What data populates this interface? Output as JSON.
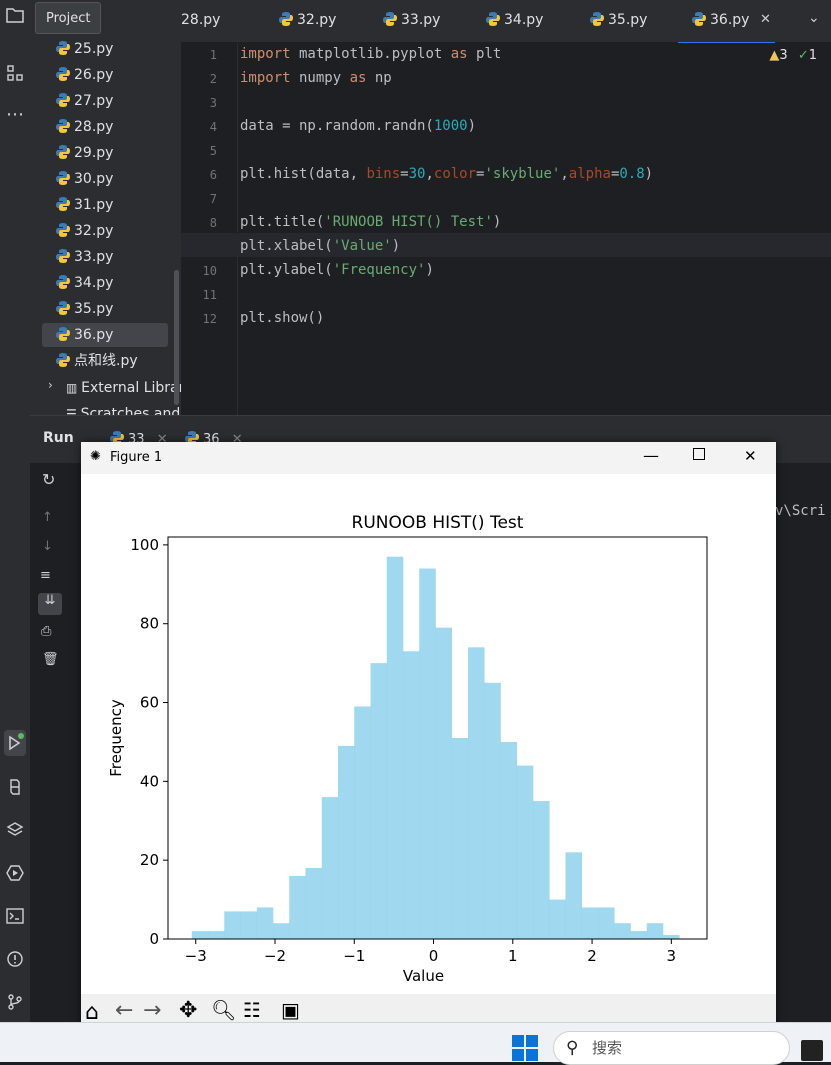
{
  "project": {
    "tab_label": "Project",
    "files": [
      "25.py",
      "26.py",
      "27.py",
      "28.py",
      "29.py",
      "30.py",
      "31.py",
      "32.py",
      "33.py",
      "34.py",
      "35.py",
      "36.py",
      "点和线.py"
    ],
    "external_libraries": "External Librarie",
    "scratches": "Scratches and C"
  },
  "tabs": [
    "28.py",
    "32.py",
    "33.py",
    "34.py",
    "35.py",
    "36.py"
  ],
  "inspection": {
    "warnings": "3",
    "ok": "1"
  },
  "code_lines": [
    "import matplotlib.pyplot as plt",
    "import numpy as np",
    "",
    "data = np.random.randn(1000)",
    "",
    "plt.hist(data, bins=30,color='skyblue',alpha=0.8)",
    "",
    "plt.title('RUNOOB HIST() Test')",
    "plt.xlabel('Value')",
    "plt.ylabel('Frequency')",
    "",
    "plt.show()"
  ],
  "run": {
    "label": "Run",
    "tab1": "33",
    "tab2": "36",
    "console_text": "v\\Scri"
  },
  "figure": {
    "window_title": "Figure 1"
  },
  "chart_data": {
    "type": "bar",
    "title": "RUNOOB HIST() Test",
    "xlabel": "Value",
    "ylabel": "Frequency",
    "color": "#87ceeb",
    "alpha": 0.8,
    "bin_edges_start": -3.05,
    "bin_width": 0.205,
    "values": [
      2,
      2,
      7,
      7,
      8,
      4,
      16,
      18,
      36,
      49,
      59,
      70,
      97,
      73,
      94,
      79,
      51,
      74,
      65,
      50,
      44,
      35,
      10,
      22,
      8,
      8,
      4,
      2,
      4,
      1
    ],
    "xlim": [
      -3.35,
      3.45
    ],
    "ylim": [
      0,
      102
    ],
    "xticks": [
      -3,
      -2,
      -1,
      0,
      1,
      2,
      3
    ],
    "xtick_labels": [
      "−3",
      "−2",
      "−1",
      "0",
      "1",
      "2",
      "3"
    ],
    "yticks": [
      0,
      20,
      40,
      60,
      80,
      100
    ],
    "ytick_labels": [
      "0",
      "20",
      "40",
      "60",
      "80",
      "100"
    ],
    "grid": false
  },
  "taskbar": {
    "search_placeholder": "搜索"
  }
}
